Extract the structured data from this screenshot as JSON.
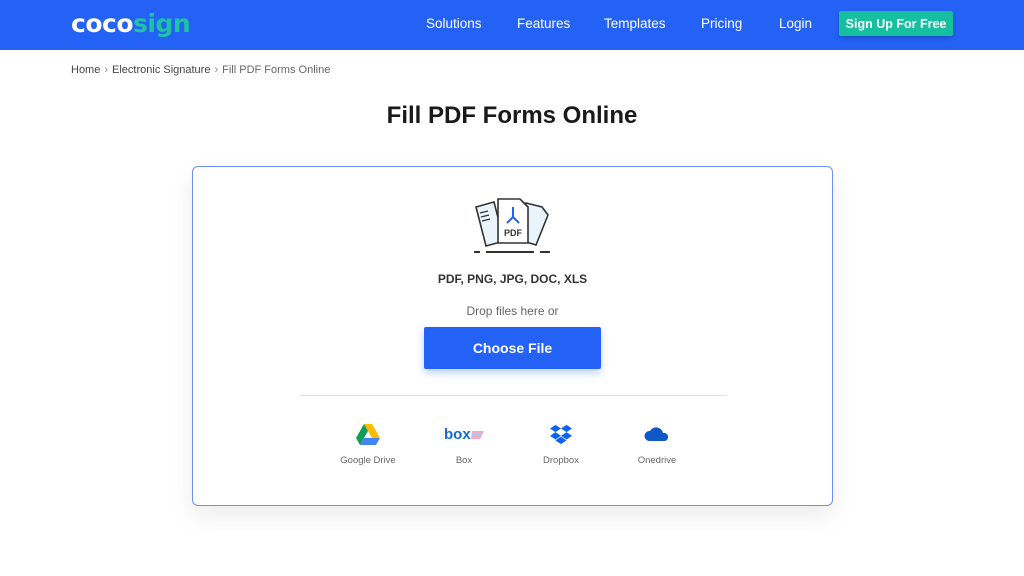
{
  "nav": {
    "logo_a": "coco",
    "logo_b": "sign",
    "links": [
      "Solutions",
      "Features",
      "Templates",
      "Pricing",
      "Login"
    ],
    "signup": "Sign Up For Free"
  },
  "breadcrumb": [
    "Home",
    "Electronic Signature",
    "Fill PDF Forms Online"
  ],
  "title": "Fill PDF Forms Online",
  "upload": {
    "types": "PDF, PNG, JPG, DOC, XLS",
    "drop": "Drop files here or",
    "choose": "Choose File",
    "icon_label": "PDF",
    "sources": [
      {
        "label": "Google Drive",
        "icon": "google-drive-icon"
      },
      {
        "label": "Box",
        "icon": "box-icon"
      },
      {
        "label": "Dropbox",
        "icon": "dropbox-icon"
      },
      {
        "label": "Onedrive",
        "icon": "onedrive-icon"
      }
    ]
  },
  "colors": {
    "primary": "#2462f5",
    "accent": "#15bf9f"
  }
}
